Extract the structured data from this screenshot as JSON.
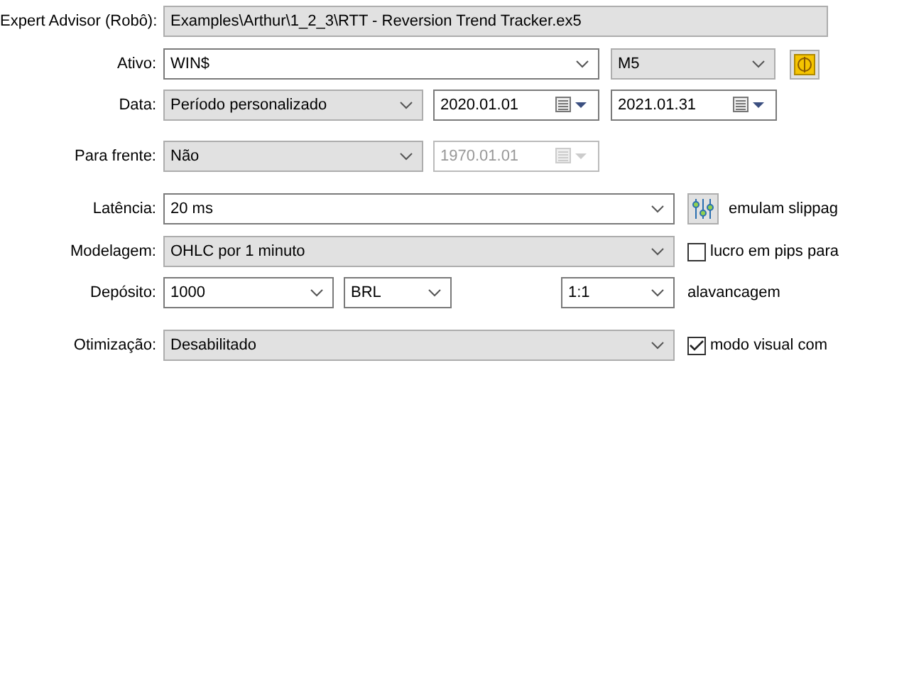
{
  "expert_advisor": {
    "label": "Expert Advisor (Robô):",
    "value": "Examples\\Arthur\\1_2_3\\RTT - Reversion Trend Tracker.ex5"
  },
  "ativo": {
    "label": "Ativo:",
    "symbol": "WIN$",
    "timeframe": "M5"
  },
  "data": {
    "label": "Data:",
    "period": "Período personalizado",
    "from": "2020.01.01",
    "to": "2021.01.31"
  },
  "para_frente": {
    "label": "Para frente:",
    "value": "Não",
    "date": "1970.01.01",
    "date_disabled": true
  },
  "latencia": {
    "label": "Latência:",
    "value": "20 ms",
    "option_text": "emulam slippag"
  },
  "modelagem": {
    "label": "Modelagem:",
    "value": "OHLC por 1 minuto",
    "checkbox": {
      "label": "lucro em pips para",
      "checked": false
    }
  },
  "deposito": {
    "label": "Depósito:",
    "amount": "1000",
    "currency": "BRL",
    "leverage": "1:1",
    "leverage_label": "alavancagem"
  },
  "otimizacao": {
    "label": "Otimização:",
    "value": "Desabilitado",
    "checkbox": {
      "label": "modo visual com",
      "checked": true
    }
  }
}
